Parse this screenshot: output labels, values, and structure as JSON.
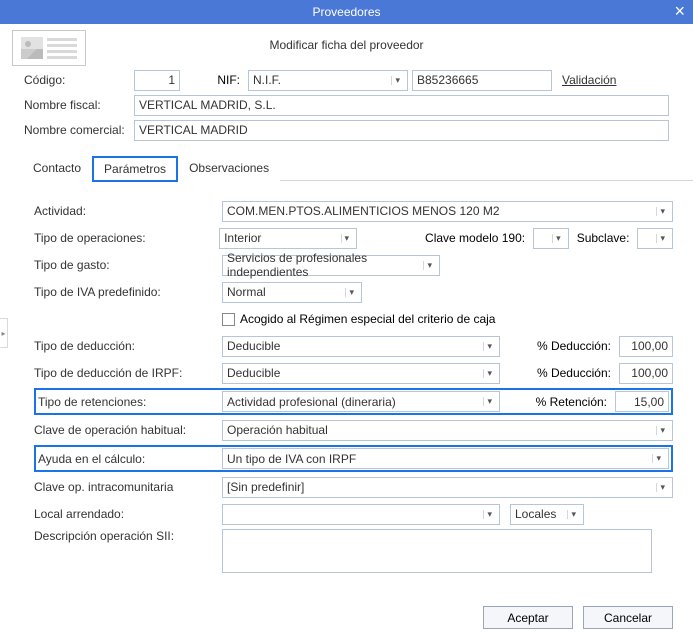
{
  "window": {
    "title": "Proveedores"
  },
  "subtitle": "Modificar ficha del proveedor",
  "top": {
    "codigo_label": "Código:",
    "codigo_value": "1",
    "nif_label": "NIF:",
    "nif_type": "N.I.F.",
    "nif_value": "B85236665",
    "validacion": "Validación",
    "nombre_fiscal_label": "Nombre fiscal:",
    "nombre_fiscal_value": "VERTICAL MADRID, S.L.",
    "nombre_comercial_label": "Nombre comercial:",
    "nombre_comercial_value": "VERTICAL MADRID"
  },
  "tabs": {
    "contacto": "Contacto",
    "parametros": "Parámetros",
    "observaciones": "Observaciones"
  },
  "params": {
    "actividad_label": "Actividad:",
    "actividad_value": "COM.MEN.PTOS.ALIMENTICIOS MENOS 120 M2",
    "tipo_op_label": "Tipo de operaciones:",
    "tipo_op_value": "Interior",
    "clave190_label": "Clave modelo 190:",
    "clave190_value": "",
    "subclave_label": "Subclave:",
    "subclave_value": "",
    "tipo_gasto_label": "Tipo de gasto:",
    "tipo_gasto_value": "Servicios de profesionales independientes",
    "tipo_iva_label": "Tipo de IVA predefinido:",
    "tipo_iva_value": "Normal",
    "acogido_label": "Acogido al Régimen especial del criterio de caja",
    "tipo_deduccion_label": "Tipo de deducción:",
    "tipo_deduccion_value": "Deducible",
    "pct_deduccion_label": "% Deducción:",
    "pct_deduccion_value": "100,00",
    "tipo_deduccion_irpf_label": "Tipo de deducción de IRPF:",
    "tipo_deduccion_irpf_value": "Deducible",
    "pct_deduccion_irpf_value": "100,00",
    "tipo_retenciones_label": "Tipo de retenciones:",
    "tipo_retenciones_value": "Actividad profesional (dineraria)",
    "pct_retencion_label": "% Retención:",
    "pct_retencion_value": "15,00",
    "clave_op_hab_label": "Clave de operación habitual:",
    "clave_op_hab_value": "Operación habitual",
    "ayuda_calc_label": "Ayuda en el cálculo:",
    "ayuda_calc_value": "Un tipo de IVA con IRPF",
    "clave_intra_label": "Clave op. intracomunitaria",
    "clave_intra_value": "[Sin predefinir]",
    "local_arr_label": "Local arrendado:",
    "local_arr_value": "",
    "locales_btn": "Locales",
    "desc_sii_label": "Descripción operación SII:",
    "desc_sii_value": ""
  },
  "buttons": {
    "accept": "Aceptar",
    "cancel": "Cancelar"
  }
}
